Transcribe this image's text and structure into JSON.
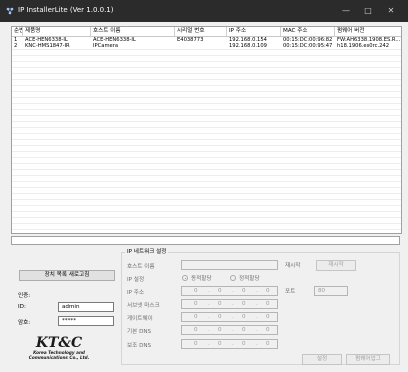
{
  "window": {
    "title": "IP InstallerLite (Ver 1.0.0.1)",
    "controls": {
      "minimize": "—",
      "maximize": "□",
      "close": "✕"
    }
  },
  "table": {
    "columns": [
      "순번",
      "제품명",
      "호스트 이름",
      "시리얼 번호",
      "IP 주소",
      "MAC 주소",
      "펌웨어 버전"
    ],
    "rows": [
      [
        "1",
        "ACE-HEN6338-IL",
        "ACE-HEN6338-IL",
        "E4038773",
        "192.168.0.154",
        "00:15:DC:00:96:82",
        "FW:AH6338.1908.ES.R..."
      ],
      [
        "2",
        "KNC-HMS1847-IR",
        "IPCamera",
        "",
        "192.168.0.109",
        "00:15:DC:00:95:47",
        "h18.1906.es0rc.242"
      ]
    ]
  },
  "left": {
    "refresh_button": "장치 목록 새로고침",
    "auth_label": "인증:",
    "id_label": "ID:",
    "id_value": "admin",
    "pw_label": "암호:",
    "pw_value": "*****",
    "logo_main": "KT&C",
    "logo_sub1": "Korea Technology and",
    "logo_sub2": "Communications Co., Ltd."
  },
  "network": {
    "group_title": "IP 네트워크 설정",
    "host_label": "호스트 이름",
    "ip_setting_label": "IP 설정",
    "radio_auto": "동적할당",
    "radio_static": "정적할당",
    "ip_label": "IP 주소",
    "subnet_label": "서브넷 마스크",
    "gateway_label": "게이트웨이",
    "dns1_label": "기본 DNS",
    "dns2_label": "보조 DNS",
    "restart_label": "재시작",
    "restart_button": "재시작",
    "port_label": "포트",
    "port_value": "80",
    "ip_placeholder": "0",
    "dot": ".",
    "apply_button": "설정",
    "upgrade_button": "펌웨어업그"
  },
  "colors": {
    "titlebar": "#2b2b2b",
    "window_bg": "#f0f0f0",
    "logo": "#1a1a1a"
  }
}
